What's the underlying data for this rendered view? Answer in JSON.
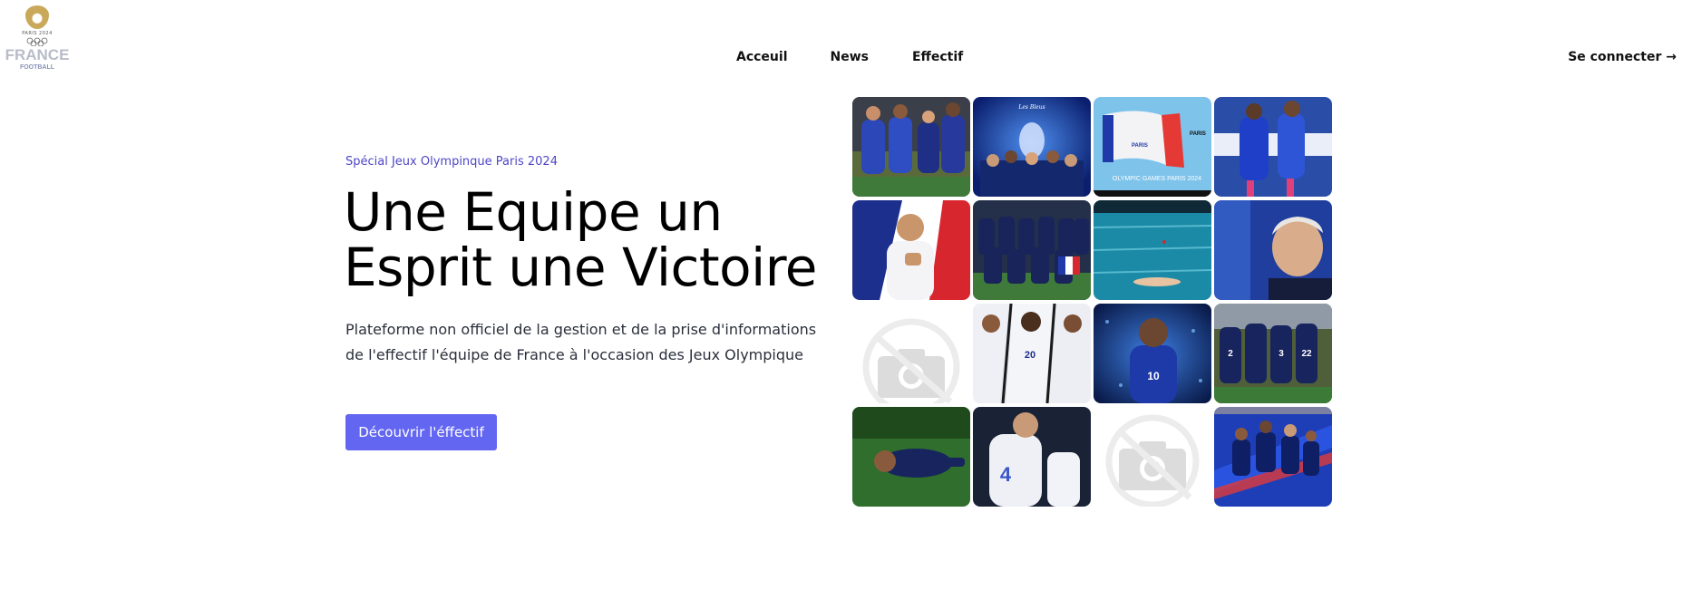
{
  "brand": {
    "logo_top": "PARIS 2024",
    "logo_main": "FRANCE",
    "logo_sub": "FOOTBALL",
    "gold": "#c9a85a"
  },
  "nav": {
    "items": [
      "Acceuil",
      "News",
      "Effectif"
    ],
    "login": "Se connecter →"
  },
  "hero": {
    "eyebrow": "Spécial Jeux Olympinque Paris 2024",
    "title_line1": "Une Equipe un",
    "title_line2": "Esprit une Victoire",
    "description": "Plateforme non officiel de la gestion et de la prise d'informations de l'effectif l'équipe de France à l'occasion des Jeux Olympique",
    "cta": "Découvrir l'éffectif",
    "accent": "#6366f1"
  },
  "gallery": {
    "tiles": [
      {
        "name": "photo-players-celebrating",
        "kind": "photo"
      },
      {
        "name": "photo-team-trophy-poster",
        "kind": "photo",
        "caption": "Les Bleus"
      },
      {
        "name": "photo-paris-olympic-flag",
        "kind": "photo",
        "caption": "OLYMPIC GAMES PARIS 2024",
        "flag_label": "PARIS"
      },
      {
        "name": "photo-players-running",
        "kind": "photo"
      },
      {
        "name": "photo-player-hand-on-chest",
        "kind": "photo"
      },
      {
        "name": "photo-team-lineup",
        "kind": "photo"
      },
      {
        "name": "photo-swimming-pool",
        "kind": "photo"
      },
      {
        "name": "photo-coach-portrait",
        "kind": "photo"
      },
      {
        "name": "image-placeholder",
        "kind": "placeholder"
      },
      {
        "name": "photo-three-players",
        "kind": "photo",
        "number": "20"
      },
      {
        "name": "photo-player-number-10",
        "kind": "photo",
        "number": "10"
      },
      {
        "name": "photo-team-huddle",
        "kind": "photo",
        "numbers": [
          "2",
          "3",
          "22"
        ]
      },
      {
        "name": "photo-player-on-ground",
        "kind": "photo"
      },
      {
        "name": "photo-player-white-kit",
        "kind": "photo",
        "number": "4"
      },
      {
        "name": "image-placeholder",
        "kind": "placeholder"
      },
      {
        "name": "photo-team-celebration-blue",
        "kind": "photo"
      }
    ]
  }
}
